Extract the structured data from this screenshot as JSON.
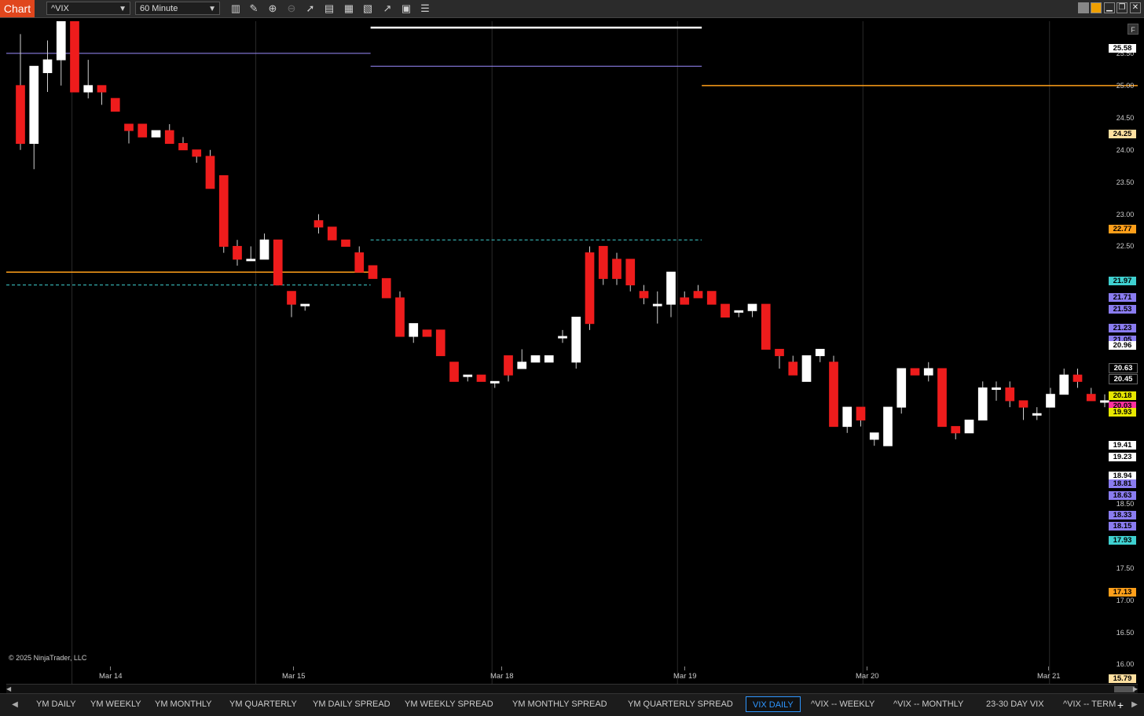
{
  "app": {
    "title": "Chart",
    "symbol": "^VIX",
    "interval": "60 Minute",
    "copyright": "© 2025 NinjaTrader, LLC",
    "f_button": "F"
  },
  "toolbar_icons": [
    "bars-icon",
    "pencil-icon",
    "zoom-in-icon",
    "zoom-out-icon",
    "pointer-icon",
    "data-box-icon",
    "properties-icon",
    "strategies-icon",
    "indicators-icon",
    "templates-icon",
    "more-icon"
  ],
  "window_buttons": [
    "minimize-icon",
    "restore-icon",
    "close-icon"
  ],
  "colors": {
    "up": "#ffffff",
    "down": "#ee1c1c",
    "weekly": "#9b8cff",
    "daily": "#ffffff",
    "monthly": "#ff9f1a",
    "quarterly": "#ffe0a0",
    "cyan": "#3fd0d0",
    "magenta": "#ff2fa0",
    "yellow": "#e7e700",
    "active_tab": "#2e96ff"
  },
  "y_axis": {
    "labels": [
      "25.50",
      "25.00",
      "24.50",
      "24.00",
      "23.50",
      "23.00",
      "22.50",
      "18.50",
      "17.50",
      "17.00",
      "16.50",
      "16.00"
    ]
  },
  "price_tags": [
    {
      "text": "25.58",
      "bg": "#ffffff"
    },
    {
      "text": "24.25",
      "bg": "#ffe0a0"
    },
    {
      "text": "22.77",
      "bg": "#ff9f1a"
    },
    {
      "text": "21.97",
      "bg": "#3fd0d0"
    },
    {
      "text": "21.71",
      "bg": "#8a7cf0"
    },
    {
      "text": "21.53",
      "bg": "#8a7cf0"
    },
    {
      "text": "21.23",
      "bg": "#8a7cf0"
    },
    {
      "text": "21.05",
      "bg": "#8a7cf0"
    },
    {
      "text": "20.96",
      "bg": "#ffffff"
    },
    {
      "text": "20.63",
      "bg": "#000000"
    },
    {
      "text": "20.45",
      "bg": "#000000"
    },
    {
      "text": "20.18",
      "bg": "#e7e700"
    },
    {
      "text": "20.03",
      "bg": "#ff2fa0"
    },
    {
      "text": "19.93",
      "bg": "#e7e700"
    },
    {
      "text": "19.41",
      "bg": "#ffffff"
    },
    {
      "text": "19.23",
      "bg": "#ffffff"
    },
    {
      "text": "18.94",
      "bg": "#ffffff"
    },
    {
      "text": "18.81",
      "bg": "#8a7cf0"
    },
    {
      "text": "18.63",
      "bg": "#8a7cf0"
    },
    {
      "text": "18.33",
      "bg": "#8a7cf0"
    },
    {
      "text": "18.15",
      "bg": "#8a7cf0"
    },
    {
      "text": "17.93",
      "bg": "#3fd0d0"
    },
    {
      "text": "17.13",
      "bg": "#ff9f1a"
    },
    {
      "text": "15.79",
      "bg": "#ffe0a0"
    }
  ],
  "x_axis": {
    "labels": [
      "Mar 14",
      "Mar 15",
      "Mar 18",
      "Mar 19",
      "Mar 20",
      "Mar 21"
    ]
  },
  "tabs": [
    "YM DAILY",
    "YM WEEKLY",
    "YM MONTHLY",
    "YM QUARTERLY",
    "YM DAILY SPREAD",
    "YM WEEKLY SPREAD",
    "YM MONTHLY SPREAD",
    "YM QUARTERLY SPREAD",
    "VIX DAILY",
    "^VIX -- WEEKLY",
    "^VIX -- MONTHLY",
    "23-30 DAY VIX",
    "^VIX -- TERM"
  ],
  "active_tab": "VIX DAILY",
  "chart_data": {
    "type": "candlestick",
    "symbol": "^VIX",
    "interval": "60 Minute",
    "y_range": [
      15.7,
      26.0
    ],
    "x_labels": [
      "Mar 14",
      "Mar 15",
      "Mar 18",
      "Mar 19",
      "Mar 20",
      "Mar 21"
    ],
    "candles": [
      [
        25.0,
        25.8,
        24.0,
        24.1
      ],
      [
        24.1,
        25.3,
        23.7,
        25.3
      ],
      [
        25.2,
        25.7,
        24.9,
        25.4
      ],
      [
        25.4,
        26.0,
        25.0,
        26.0
      ],
      [
        26.0,
        26.0,
        24.9,
        24.9
      ],
      [
        24.9,
        25.4,
        24.8,
        25.0
      ],
      [
        25.0,
        25.0,
        24.7,
        24.9
      ],
      [
        24.8,
        24.8,
        24.6,
        24.6
      ],
      [
        24.4,
        24.4,
        24.1,
        24.3
      ],
      [
        24.4,
        24.4,
        24.2,
        24.2
      ],
      [
        24.2,
        24.3,
        24.2,
        24.3
      ],
      [
        24.3,
        24.4,
        24.1,
        24.1
      ],
      [
        24.1,
        24.2,
        24.0,
        24.0
      ],
      [
        24.0,
        24.0,
        23.8,
        23.9
      ],
      [
        23.9,
        24.0,
        23.5,
        23.4
      ],
      [
        23.6,
        23.6,
        22.4,
        22.5
      ],
      [
        22.5,
        22.6,
        22.2,
        22.3
      ],
      [
        22.3,
        22.5,
        22.3,
        22.3
      ],
      [
        22.3,
        22.7,
        22.3,
        22.6
      ],
      [
        22.6,
        22.6,
        21.9,
        21.9
      ],
      [
        21.8,
        21.8,
        21.4,
        21.6
      ],
      [
        21.6,
        21.6,
        21.5,
        21.6
      ],
      [
        22.9,
        23.0,
        22.7,
        22.8
      ],
      [
        22.8,
        22.8,
        22.6,
        22.6
      ],
      [
        22.6,
        22.6,
        22.5,
        22.5
      ],
      [
        22.4,
        22.5,
        22.1,
        22.1
      ],
      [
        22.2,
        22.2,
        22.0,
        22.0
      ],
      [
        22.0,
        22.0,
        21.7,
        21.7
      ],
      [
        21.7,
        21.8,
        21.1,
        21.1
      ],
      [
        21.1,
        21.3,
        21.0,
        21.3
      ],
      [
        21.2,
        21.2,
        21.1,
        21.1
      ],
      [
        21.2,
        21.2,
        20.8,
        20.8
      ],
      [
        20.7,
        20.7,
        20.4,
        20.4
      ],
      [
        20.5,
        20.5,
        20.4,
        20.5
      ],
      [
        20.5,
        20.5,
        20.4,
        20.4
      ],
      [
        20.4,
        20.4,
        20.3,
        20.4
      ],
      [
        20.8,
        20.8,
        20.4,
        20.5
      ],
      [
        20.6,
        20.9,
        20.6,
        20.7
      ],
      [
        20.7,
        20.8,
        20.7,
        20.8
      ],
      [
        20.7,
        20.7,
        20.7,
        20.8
      ],
      [
        21.1,
        21.2,
        21.0,
        21.1
      ],
      [
        20.7,
        21.4,
        20.6,
        21.4
      ],
      [
        22.4,
        22.5,
        21.2,
        21.3
      ],
      [
        22.5,
        22.5,
        21.9,
        22.0
      ],
      [
        22.3,
        22.4,
        21.9,
        22.0
      ],
      [
        22.3,
        22.3,
        21.8,
        21.9
      ],
      [
        21.8,
        21.9,
        21.6,
        21.7
      ],
      [
        21.6,
        21.8,
        21.3,
        21.6
      ],
      [
        21.6,
        22.0,
        21.4,
        22.1
      ],
      [
        21.7,
        21.8,
        21.6,
        21.6
      ],
      [
        21.8,
        21.9,
        21.7,
        21.7
      ],
      [
        21.8,
        21.8,
        21.6,
        21.6
      ],
      [
        21.6,
        21.6,
        21.4,
        21.4
      ],
      [
        21.5,
        21.5,
        21.4,
        21.5
      ],
      [
        21.5,
        21.6,
        21.4,
        21.6
      ],
      [
        21.6,
        21.6,
        20.9,
        20.9
      ],
      [
        20.9,
        20.9,
        20.6,
        20.8
      ],
      [
        20.7,
        20.8,
        20.5,
        20.5
      ],
      [
        20.4,
        20.8,
        20.4,
        20.8
      ],
      [
        20.8,
        20.8,
        20.7,
        20.9
      ],
      [
        20.7,
        20.8,
        19.8,
        19.7
      ],
      [
        19.7,
        20.0,
        19.6,
        20.0
      ],
      [
        20.0,
        20.0,
        19.7,
        19.8
      ],
      [
        19.5,
        19.6,
        19.4,
        19.6
      ],
      [
        19.4,
        20.0,
        19.4,
        20.0
      ],
      [
        20.0,
        20.6,
        19.9,
        20.6
      ],
      [
        20.6,
        20.6,
        20.5,
        20.5
      ],
      [
        20.5,
        20.7,
        20.4,
        20.6
      ],
      [
        20.6,
        20.6,
        19.7,
        19.7
      ],
      [
        19.7,
        19.7,
        19.5,
        19.6
      ],
      [
        19.6,
        19.8,
        19.6,
        19.8
      ],
      [
        19.8,
        20.4,
        19.8,
        20.3
      ],
      [
        20.3,
        20.4,
        20.1,
        20.3
      ],
      [
        20.3,
        20.4,
        20.0,
        20.1
      ],
      [
        20.1,
        20.1,
        19.8,
        20.0
      ],
      [
        19.9,
        20.0,
        19.8,
        19.9
      ],
      [
        20.0,
        20.3,
        20.0,
        20.2
      ],
      [
        20.2,
        20.6,
        20.2,
        20.5
      ],
      [
        20.5,
        20.6,
        20.3,
        20.4
      ],
      [
        20.2,
        20.3,
        20.1,
        20.1
      ],
      [
        20.1,
        20.2,
        20.0,
        20.1
      ]
    ],
    "levels": [
      {
        "color": "#ffffff",
        "width": 2.5,
        "dash": false,
        "segments": [
          [
            0,
            26.05,
            0.33
          ],
          [
            0.33,
            25.9,
            0.63
          ],
          [
            1.18,
            23.65,
            1.41
          ]
        ]
      },
      {
        "color": "#9b8cff",
        "width": 1,
        "dash": false,
        "segments": [
          [
            0,
            25.5,
            0.33
          ],
          [
            0.33,
            25.3,
            0.63
          ],
          [
            1.5,
            24.0,
            1.9
          ]
        ]
      },
      {
        "color": "#ff9f1a",
        "width": 1.5,
        "dash": false,
        "segments": [
          [
            0,
            22.1,
            0.33
          ],
          [
            0.63,
            25.0,
            1.49
          ]
        ]
      },
      {
        "color": "#3fd0d0",
        "width": 1,
        "dash": true,
        "segments": [
          [
            0,
            21.9,
            0.33
          ],
          [
            0.33,
            22.6,
            0.63
          ]
        ]
      }
    ]
  }
}
